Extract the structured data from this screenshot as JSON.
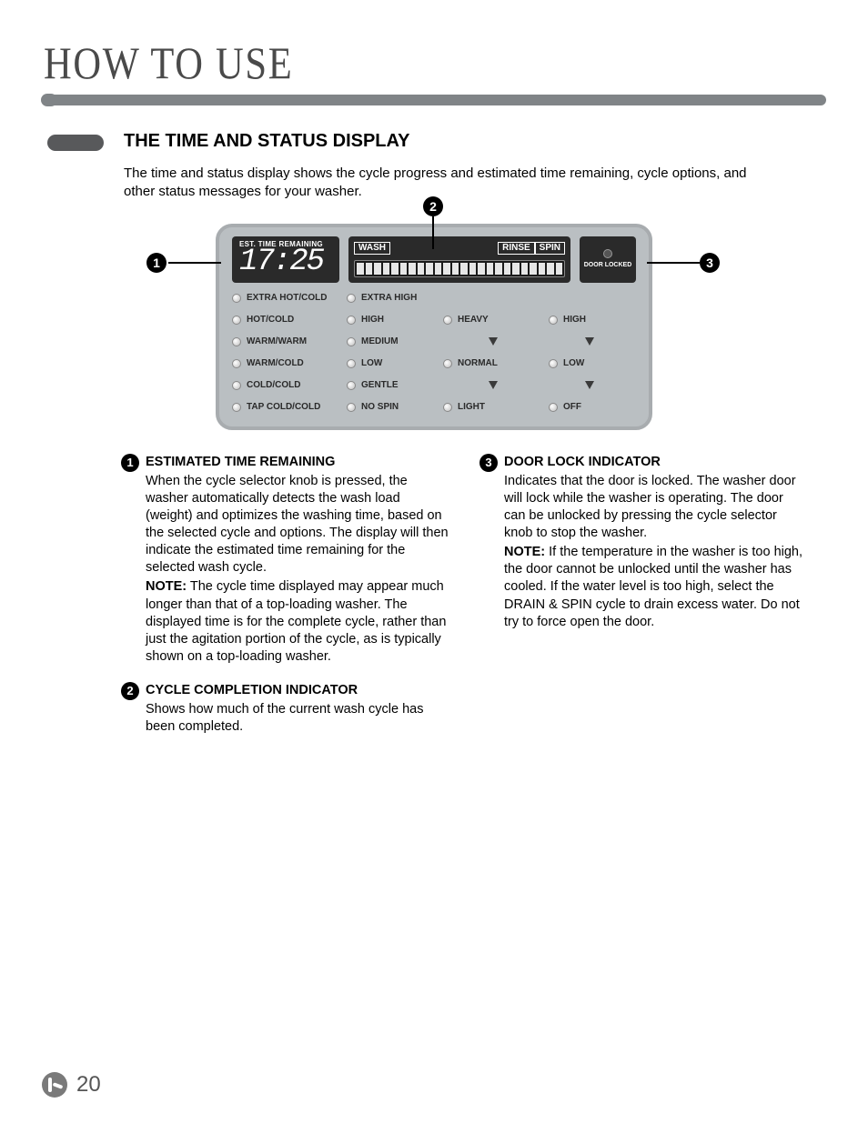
{
  "page": {
    "title": "HOW TO USE",
    "number": "20"
  },
  "section": {
    "heading": "THE TIME AND STATUS DISPLAY",
    "intro": "The time and status display shows the cycle progress and estimated time remaining, cycle options, and other status messages for your washer."
  },
  "display": {
    "est_label": "EST. TIME REMAINING",
    "time": "17:25",
    "phases": {
      "wash": "WASH",
      "rinse": "RINSE",
      "spin": "SPIN"
    },
    "door_label": "DOOR LOCKED",
    "options": {
      "col1": [
        "EXTRA HOT/COLD",
        "HOT/COLD",
        "WARM/WARM",
        "WARM/COLD",
        "COLD/COLD",
        "TAP COLD/COLD"
      ],
      "col2": [
        "EXTRA HIGH",
        "HIGH",
        "MEDIUM",
        "LOW",
        "GENTLE",
        "NO SPIN"
      ],
      "col3": [
        "",
        "HEAVY",
        "arrow",
        "NORMAL",
        "arrow",
        "LIGHT"
      ],
      "col4": [
        "",
        "HIGH",
        "arrow",
        "LOW",
        "arrow",
        "OFF"
      ]
    },
    "callouts": {
      "c1": "1",
      "c2": "2",
      "c3": "3"
    }
  },
  "items": {
    "i1": {
      "num": "1",
      "title": "ESTIMATED TIME REMAINING",
      "body": "When the cycle selector knob is pressed, the washer automatically detects the wash load (weight) and optimizes the washing time, based on the selected cycle and options. The display will then indicate the estimated time remaining for the selected wash cycle.",
      "note_lead": "NOTE:",
      "note": " The cycle time displayed may appear much longer than that of a top-loading washer. The displayed time is for the complete cycle, rather than just the agitation portion of the cycle, as is typically shown on a top-loading washer."
    },
    "i2": {
      "num": "2",
      "title": "CYCLE COMPLETION INDICATOR",
      "body": "Shows how much of the current wash cycle has been completed."
    },
    "i3": {
      "num": "3",
      "title": "DOOR LOCK INDICATOR",
      "body": "Indicates that the door is locked. The washer door will lock while the washer is operating. The door can be unlocked by pressing the cycle selector knob to stop the washer.",
      "note_lead": "NOTE:",
      "note": " If the temperature in the washer is too high, the door cannot be unlocked until the washer has cooled. If the water level is too high, select the DRAIN & SPIN cycle to drain excess water. Do not try to force open the door."
    }
  }
}
